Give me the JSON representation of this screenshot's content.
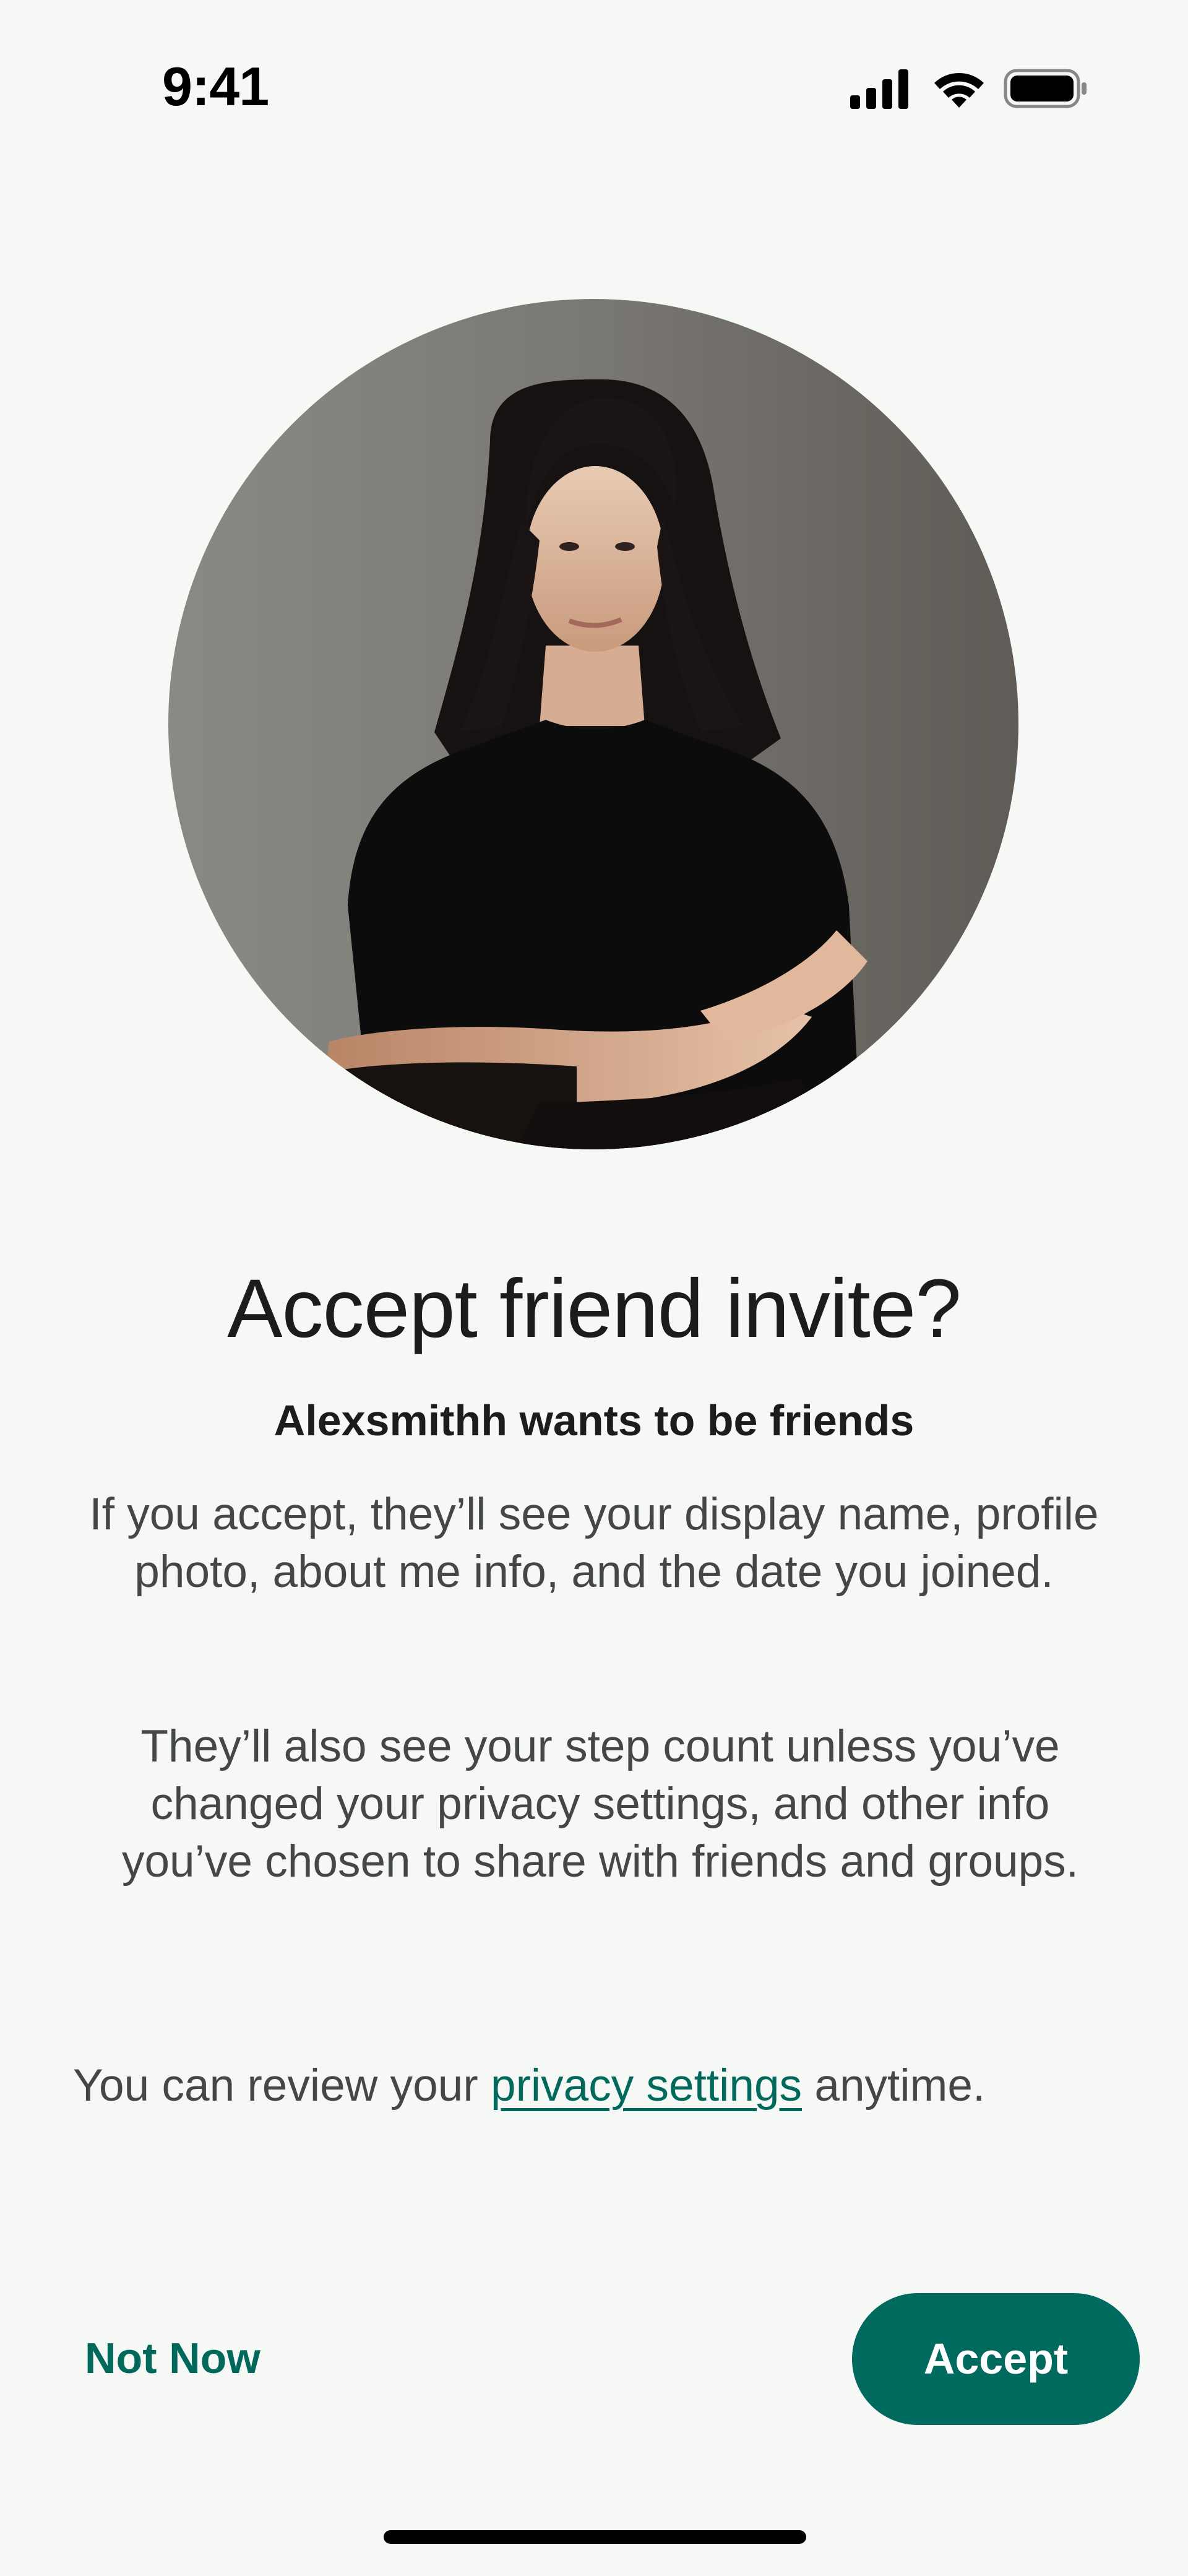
{
  "status_bar": {
    "time": "9:41",
    "icons": [
      "cellular-signal-icon",
      "wifi-icon",
      "battery-icon"
    ]
  },
  "profile": {
    "avatar": "profile-photo"
  },
  "dialog": {
    "title": "Accept friend invite?",
    "subtitle": "Alexsmithh wants to be friends",
    "paragraph_1": "If you accept, they’ll see your display name, profile photo, about me info, and the date you joined.",
    "paragraph_2": "They’ll also see your step count unless you’ve changed your privacy settings, and other info you’ve chosen to share with friends and groups.",
    "review_prefix": "You can review your ",
    "review_link": "privacy settings",
    "review_suffix": " anytime."
  },
  "actions": {
    "not_now_label": "Not Now",
    "accept_label": "Accept"
  },
  "colors": {
    "accent": "#00695C",
    "background": "#F6F8F5",
    "text_primary": "#1C1C1C",
    "text_secondary": "#444746"
  }
}
